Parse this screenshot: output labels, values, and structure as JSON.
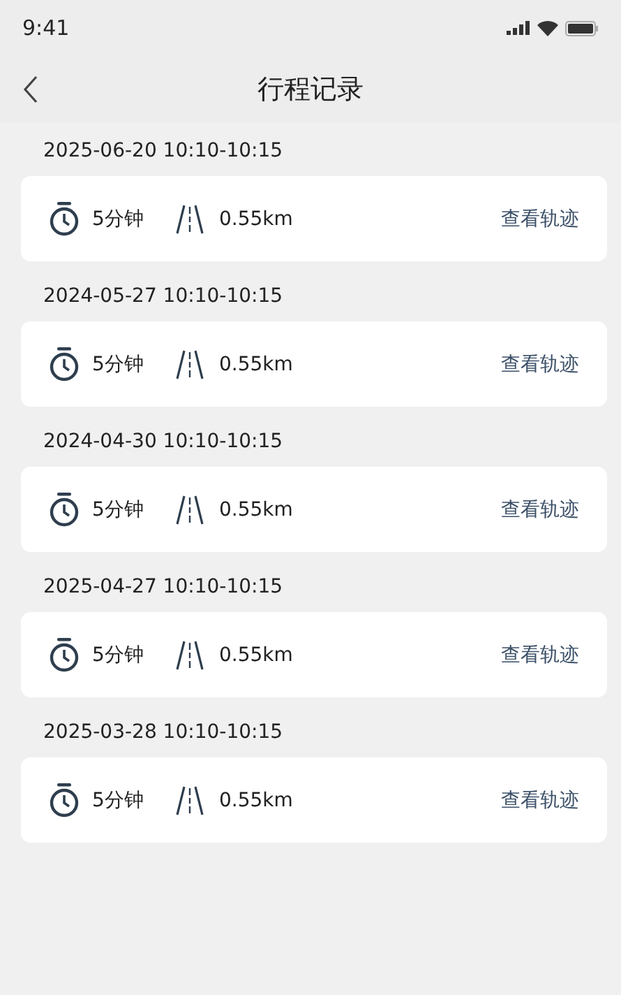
{
  "status_bar": {
    "time": "9:41"
  },
  "header": {
    "title": "行程记录"
  },
  "trips": [
    {
      "date": "2025-06-20 10:10-10:15",
      "duration": "5分钟",
      "distance": "0.55km",
      "action": "查看轨迹"
    },
    {
      "date": "2024-05-27 10:10-10:15",
      "duration": "5分钟",
      "distance": "0.55km",
      "action": "查看轨迹"
    },
    {
      "date": "2024-04-30 10:10-10:15",
      "duration": "5分钟",
      "distance": "0.55km",
      "action": "查看轨迹"
    },
    {
      "date": "2025-04-27 10:10-10:15",
      "duration": "5分钟",
      "distance": "0.55km",
      "action": "查看轨迹"
    },
    {
      "date": "2025-03-28 10:10-10:15",
      "duration": "5分钟",
      "distance": "0.55km",
      "action": "查看轨迹"
    }
  ]
}
